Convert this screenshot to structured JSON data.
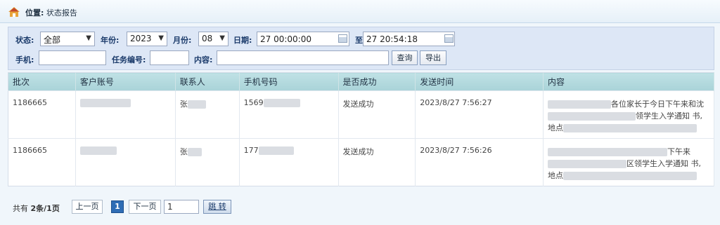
{
  "breadcrumb": {
    "location_label": "位置:",
    "page": "状态报告"
  },
  "filters": {
    "status_label": "状态:",
    "status_value": "全部",
    "year_label": "年份:",
    "year_value": "2023",
    "month_label": "月份:",
    "month_value": "08",
    "date_label": "日期:",
    "date_from": "27 00:00:00",
    "date_to_label": "至",
    "date_to": "27 20:54:18",
    "phone_label": "手机:",
    "phone_value": "",
    "task_label": "任务编号:",
    "task_value": "",
    "content_label": "内容:",
    "content_value": "",
    "query_button": "查询",
    "export_button": "导出"
  },
  "table": {
    "headers": [
      "批次",
      "客户账号",
      "联系人",
      "手机号码",
      "是否成功",
      "发送时间",
      "内容"
    ],
    "rows": [
      {
        "batch": "1186665",
        "contact": "张",
        "phone": "1569",
        "success": "发送成功",
        "time": "2023/8/27 7:56:27",
        "content_line1": "各位家长于今日下午来和沈",
        "content_line2": "领学生入学通知 书,",
        "content_line3": "地点"
      },
      {
        "batch": "1186665",
        "contact": "张",
        "phone": "177",
        "success": "发送成功",
        "time": "2023/8/27 7:56:26",
        "content_line1": "下午来",
        "content_line2": "区领学生入学通知 书,",
        "content_line3": "地点"
      }
    ]
  },
  "pager": {
    "total_prefix": "共有",
    "total_value": "2条/1页",
    "prev": "上一页",
    "current": "1",
    "next": "下一页",
    "page_input": "1",
    "jump": "跳 转"
  }
}
